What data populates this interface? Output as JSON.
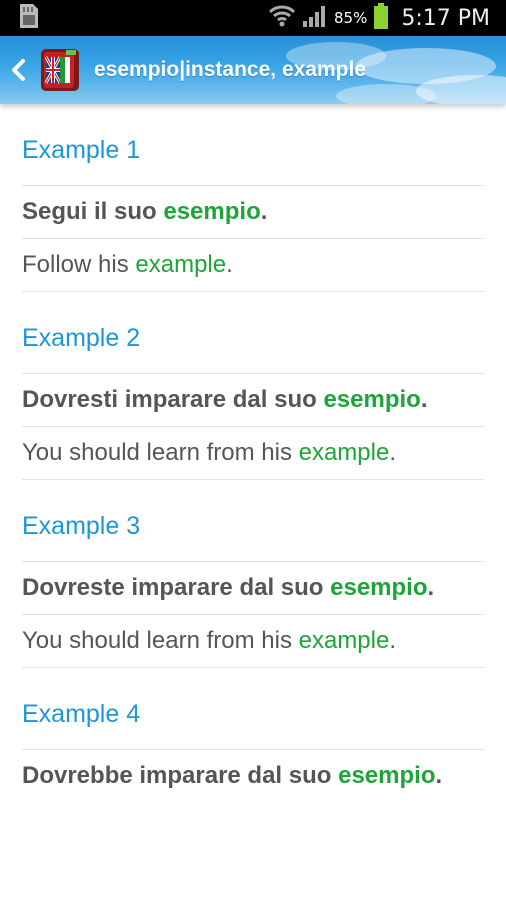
{
  "status_bar": {
    "battery_percent": "85%",
    "time": "5:17 PM"
  },
  "action_bar": {
    "title": "esempio|instance, example"
  },
  "examples": [
    {
      "header": "Example 1",
      "italian": {
        "before": "Segui il suo ",
        "highlight": "esempio",
        "after": "."
      },
      "english": {
        "before": "Follow his ",
        "highlight": "example",
        "after": "."
      }
    },
    {
      "header": "Example 2",
      "italian": {
        "before": "Dovresti imparare dal suo ",
        "highlight": "esempio",
        "after": "."
      },
      "english": {
        "before": "You should learn from his ",
        "highlight": "example",
        "after": "."
      }
    },
    {
      "header": "Example 3",
      "italian": {
        "before": "Dovreste imparare dal suo ",
        "highlight": "esempio",
        "after": "."
      },
      "english": {
        "before": "You should learn from his ",
        "highlight": "example",
        "after": "."
      }
    },
    {
      "header": "Example 4",
      "italian": {
        "before": "Dovrebbe imparare dal suo ",
        "highlight": "esempio",
        "after": "."
      }
    }
  ],
  "colors": {
    "accent_blue": "#1e96d6",
    "highlight_green": "#1fa43a",
    "body_text": "#555555"
  }
}
